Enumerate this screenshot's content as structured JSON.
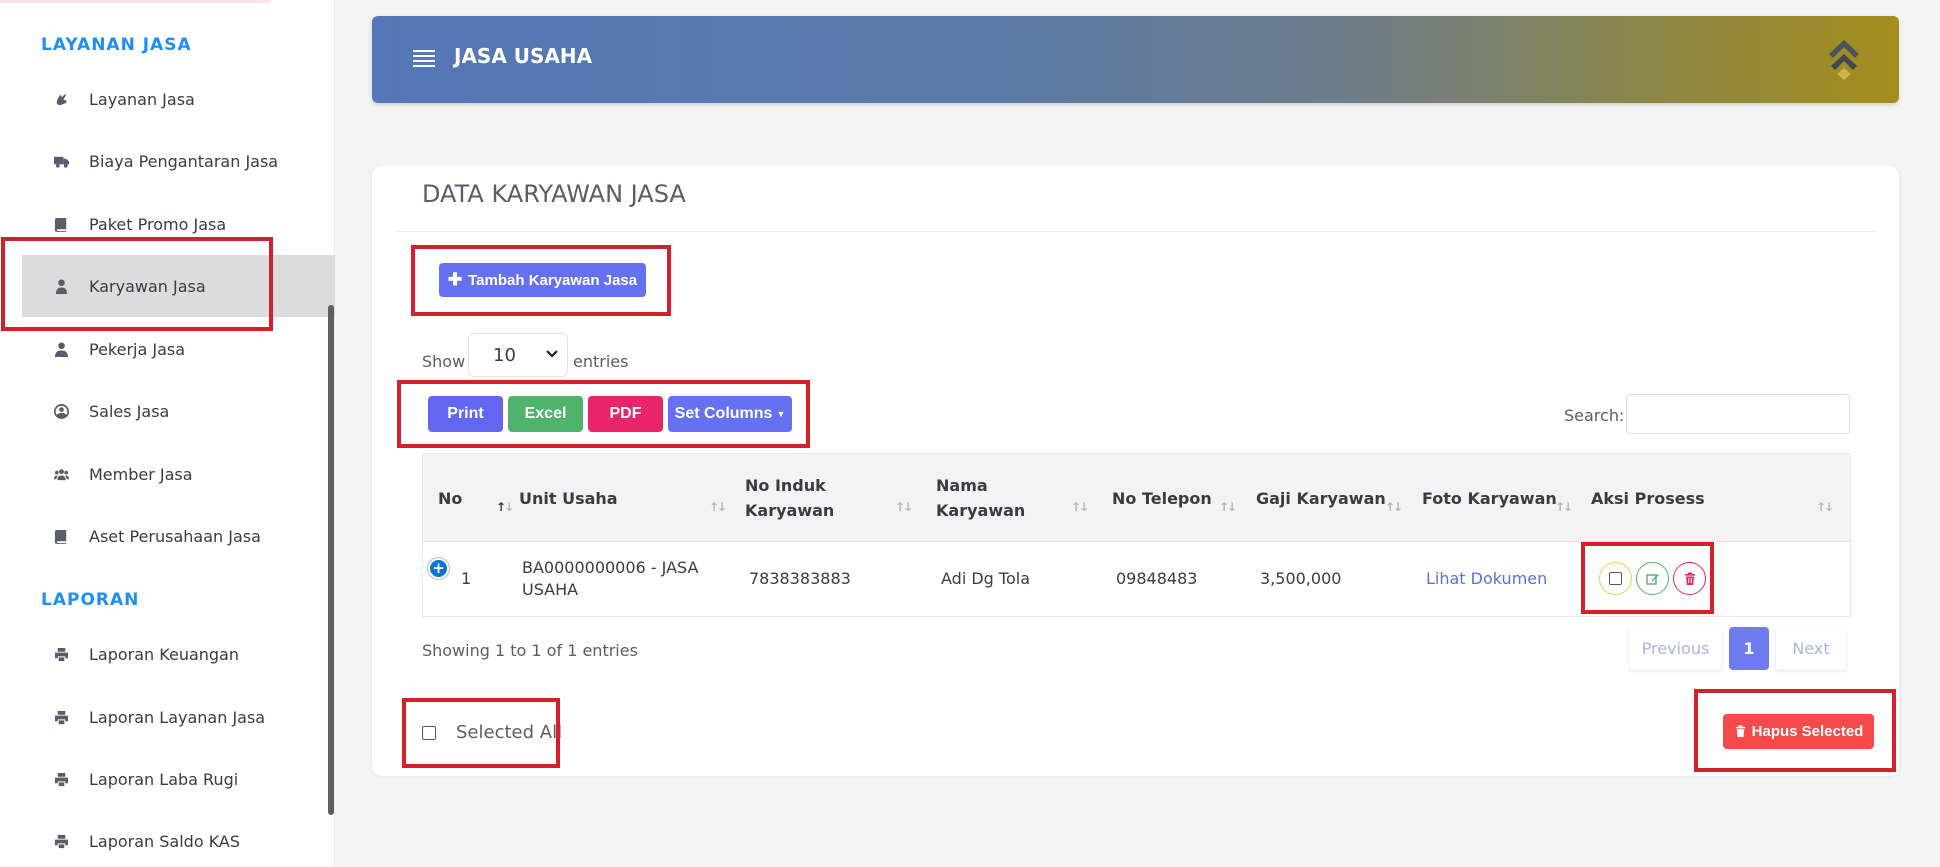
{
  "sidebar": {
    "section1": "LAYANAN JASA",
    "section2": "LAPORAN",
    "items": [
      {
        "label": "Layanan Jasa",
        "icon": "hand-icon"
      },
      {
        "label": "Biaya Pengantaran Jasa",
        "icon": "truck-icon"
      },
      {
        "label": "Paket Promo Jasa",
        "icon": "book-icon"
      },
      {
        "label": "Karyawan Jasa",
        "icon": "user-tie-icon",
        "active": true
      },
      {
        "label": "Pekerja Jasa",
        "icon": "user-icon"
      },
      {
        "label": "Sales Jasa",
        "icon": "user-circle-icon"
      },
      {
        "label": "Member Jasa",
        "icon": "users-icon"
      },
      {
        "label": "Aset Perusahaan Jasa",
        "icon": "book-icon"
      }
    ],
    "report_items": [
      {
        "label": "Laporan Keuangan",
        "icon": "print-icon"
      },
      {
        "label": "Laporan Layanan Jasa",
        "icon": "print-icon"
      },
      {
        "label": "Laporan Laba Rugi",
        "icon": "print-icon"
      },
      {
        "label": "Laporan Saldo KAS",
        "icon": "print-icon"
      }
    ]
  },
  "header": {
    "title": "JASA USAHA"
  },
  "card": {
    "title": "DATA KARYAWAN JASA",
    "add_button": "Tambah Karyawan Jasa",
    "show_label": "Show",
    "entries_value": "10",
    "entries_label": "entries",
    "export": {
      "print": "Print",
      "excel": "Excel",
      "pdf": "PDF",
      "columns": "Set Columns"
    },
    "search_label": "Search:",
    "search_value": ""
  },
  "table": {
    "headers": [
      "No",
      "Unit Usaha",
      "No Induk Karyawan",
      "Nama Karyawan",
      "No Telepon",
      "Gaji Karyawan",
      "Foto Karyawan",
      "Aksi Prosess"
    ],
    "rows": [
      {
        "no": "1",
        "unit_usaha": "BA0000000006 - JASA USAHA",
        "no_induk": "7838383883",
        "nama": "Adi Dg Tola",
        "telepon": "09848483",
        "gaji": "3,500,000",
        "foto": "Lihat Dokumen"
      }
    ]
  },
  "footer": {
    "showing": "Showing 1 to 1 of 1 entries",
    "prev": "Previous",
    "page": "1",
    "next": "Next",
    "selected_all": "Selected All",
    "hapus_selected": "Hapus Selected"
  },
  "colors": {
    "accent": "#6571f0",
    "highlight": "#d4202a",
    "heading_blue": "#1f8ff0"
  }
}
